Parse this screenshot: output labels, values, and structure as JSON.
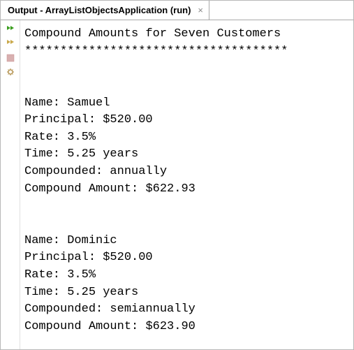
{
  "tab": {
    "title": "Output - ArrayListObjectsApplication (run)"
  },
  "output": {
    "header": "Compound Amounts for Seven Customers",
    "divider": "*************************************",
    "customers": [
      {
        "name_label": "Name: ",
        "name_value": "Samuel",
        "principal_label": "Principal: ",
        "principal_value": "$520.00",
        "rate_label": "Rate: ",
        "rate_value": "3.5%",
        "time_label": "Time: ",
        "time_value": "5.25 years",
        "compounded_label": "Compounded: ",
        "compounded_value": "annually",
        "amount_label": "Compound Amount: ",
        "amount_value": "$622.93"
      },
      {
        "name_label": "Name: ",
        "name_value": "Dominic",
        "principal_label": "Principal: ",
        "principal_value": "$520.00",
        "rate_label": "Rate: ",
        "rate_value": "3.5%",
        "time_label": "Time: ",
        "time_value": "5.25 years",
        "compounded_label": "Compounded: ",
        "compounded_value": "semiannually",
        "amount_label": "Compound Amount: ",
        "amount_value": "$623.90"
      }
    ]
  }
}
